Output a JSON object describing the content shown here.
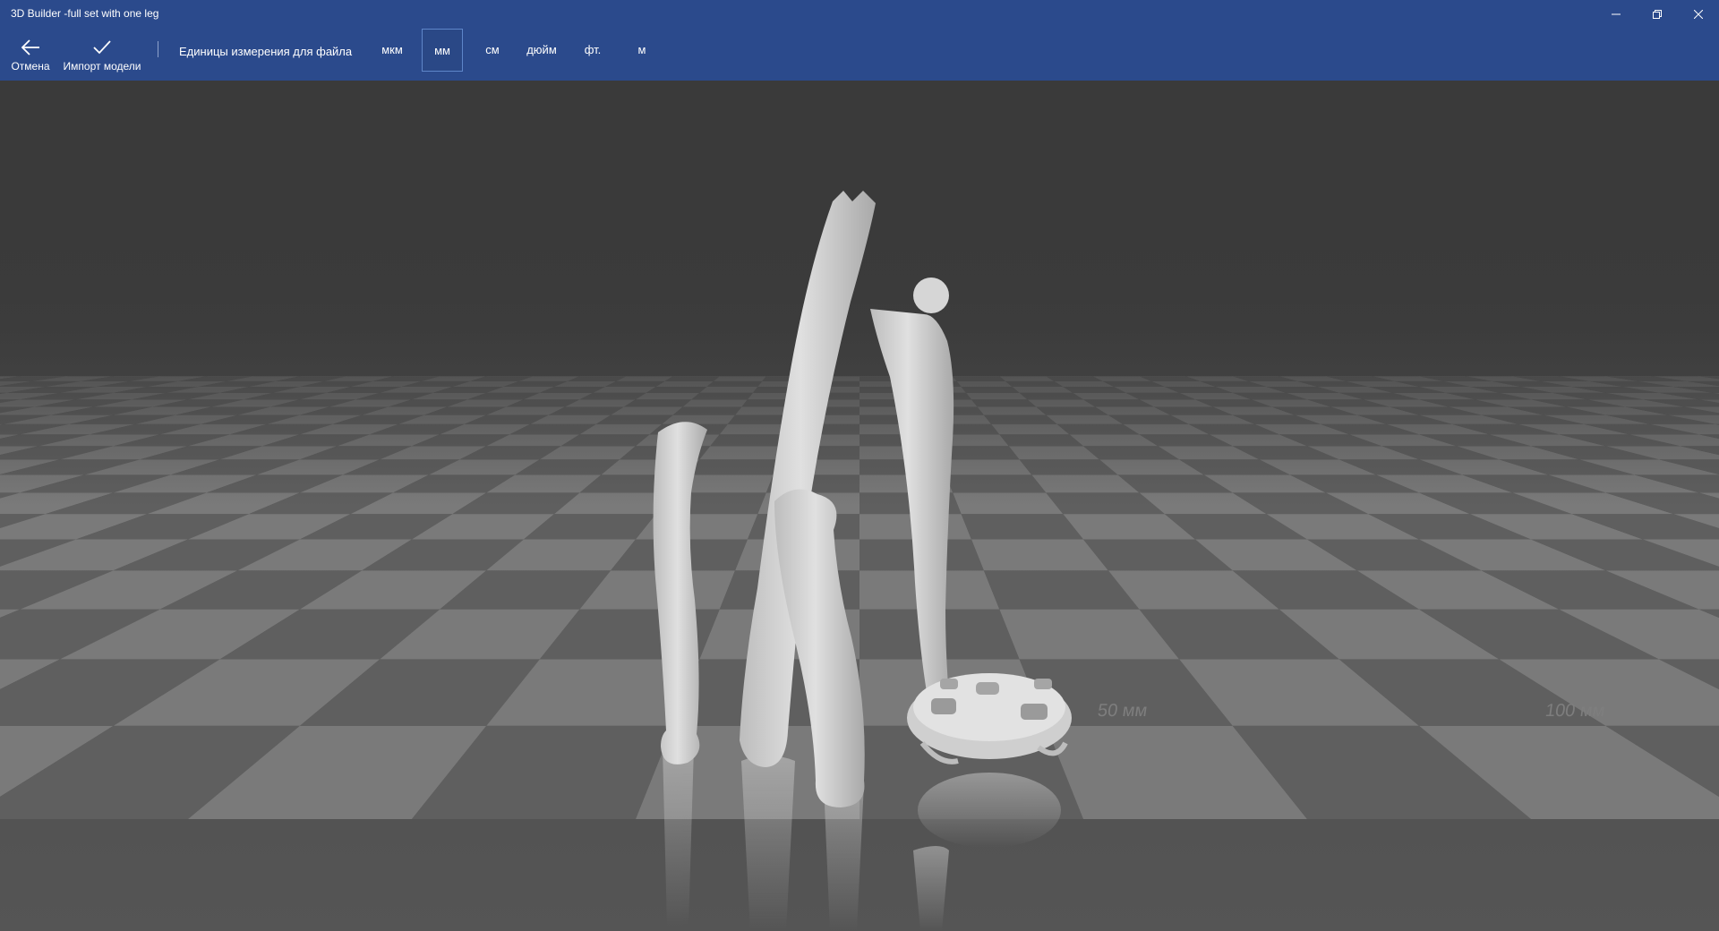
{
  "window": {
    "title": "3D Builder -full set with one leg",
    "controls": {
      "minimize_icon": "minimize-icon",
      "restore_icon": "restore-icon",
      "close_icon": "close-icon"
    }
  },
  "commandbar": {
    "cancel_label": "Отмена",
    "import_label": "Импорт модели",
    "units_label": "Единицы измерения для файла",
    "units": [
      "мкм",
      "мм",
      "см",
      "дюйм",
      "фт.",
      "м"
    ],
    "selected_unit": "мм"
  },
  "viewport": {
    "ruler_labels": [
      "50 мм",
      "100 мм"
    ]
  },
  "colors": {
    "titlebar": "#2b4a8c",
    "accent": "#5e86c9",
    "floor_dark": "#5f5f5f",
    "floor_light": "#7a7a7a",
    "model": "#d4d4d4"
  }
}
